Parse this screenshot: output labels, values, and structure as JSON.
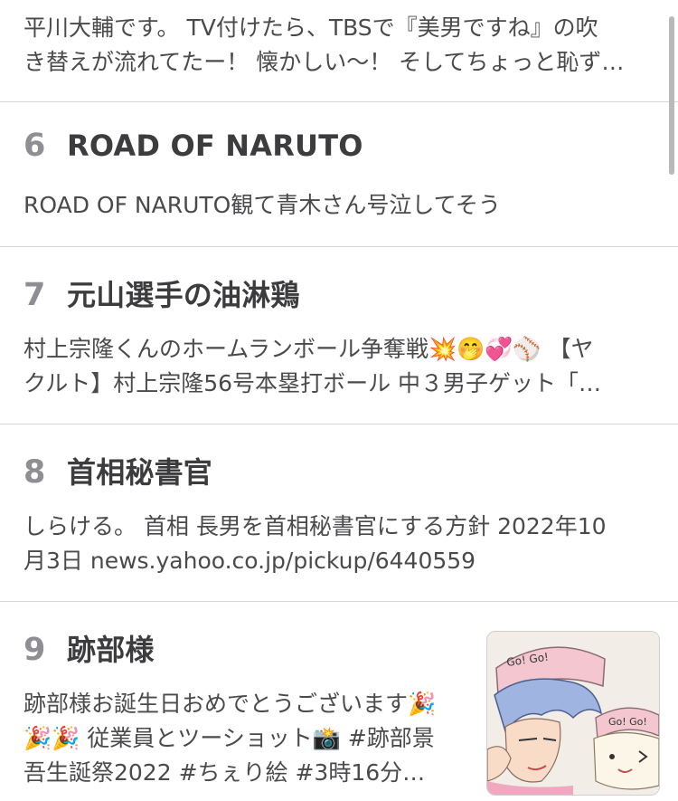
{
  "feed": {
    "items": [
      {
        "rank": "",
        "title": "",
        "desc": "平川大輔です。 TV付けたら、TBSで『美男ですね』の吹\nき替えが流れてたー！ 懐かしい〜！ そしてちょっと恥ず…"
      },
      {
        "rank": "6",
        "title": "ROAD OF NARUTO",
        "desc": "ROAD OF NARUTO観て青木さん号泣してそう"
      },
      {
        "rank": "7",
        "title": "元山選手の油淋鶏",
        "desc": "村上宗隆くんのホームランボール争奪戦💥🤭💞⚾ 【ヤ\nクルト】村上宗隆56号本塁打ボール 中３男子ゲット「…"
      },
      {
        "rank": "8",
        "title": "首相秘書官",
        "desc": "しらける。 首相 長男を首相秘書官にする方針 2022年10\n月3日 news.yahoo.co.jp/pickup/6440559"
      },
      {
        "rank": "9",
        "title": "跡部様",
        "desc": "跡部様お誕生日おめでとうございます🎉\n🎉🎉 従業員とツーショット📸 #跡部景\n吾生誕祭2022 #ちぇり絵 #3時16分…",
        "thumbnail": {
          "caption_left": "Go! Go!",
          "caption_right": "Go! Go!"
        }
      }
    ]
  },
  "colors": {
    "rank": "#8e8e93",
    "title": "#3c3c3e",
    "divider": "#d6d6d8"
  }
}
